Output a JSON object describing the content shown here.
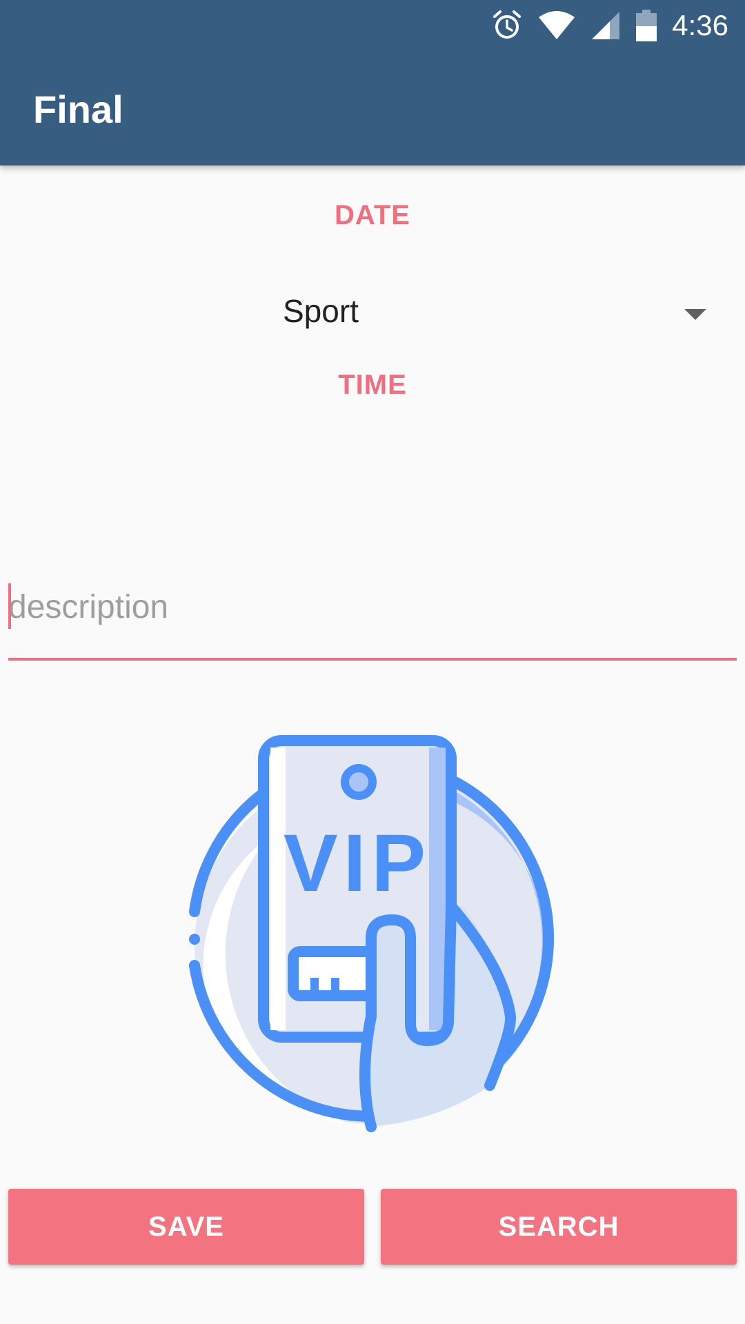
{
  "status_bar": {
    "time": "4:36",
    "icons": [
      "alarm-icon",
      "wifi-icon",
      "cell-signal-icon",
      "battery-icon"
    ]
  },
  "app_bar": {
    "title": "Final",
    "color": "#375E80"
  },
  "form": {
    "date_label": "DATE",
    "category_selected": "Sport",
    "time_label": "TIME",
    "description": {
      "value": "",
      "placeholder": "description"
    }
  },
  "image": {
    "icon": "vip-ticket-icon",
    "text": "VIP"
  },
  "actions": {
    "save_label": "SAVE",
    "search_label": "SEARCH"
  },
  "colors": {
    "accent": "#F06E7D",
    "primary": "#375E80",
    "illustration_blue": "#4A90F7"
  }
}
